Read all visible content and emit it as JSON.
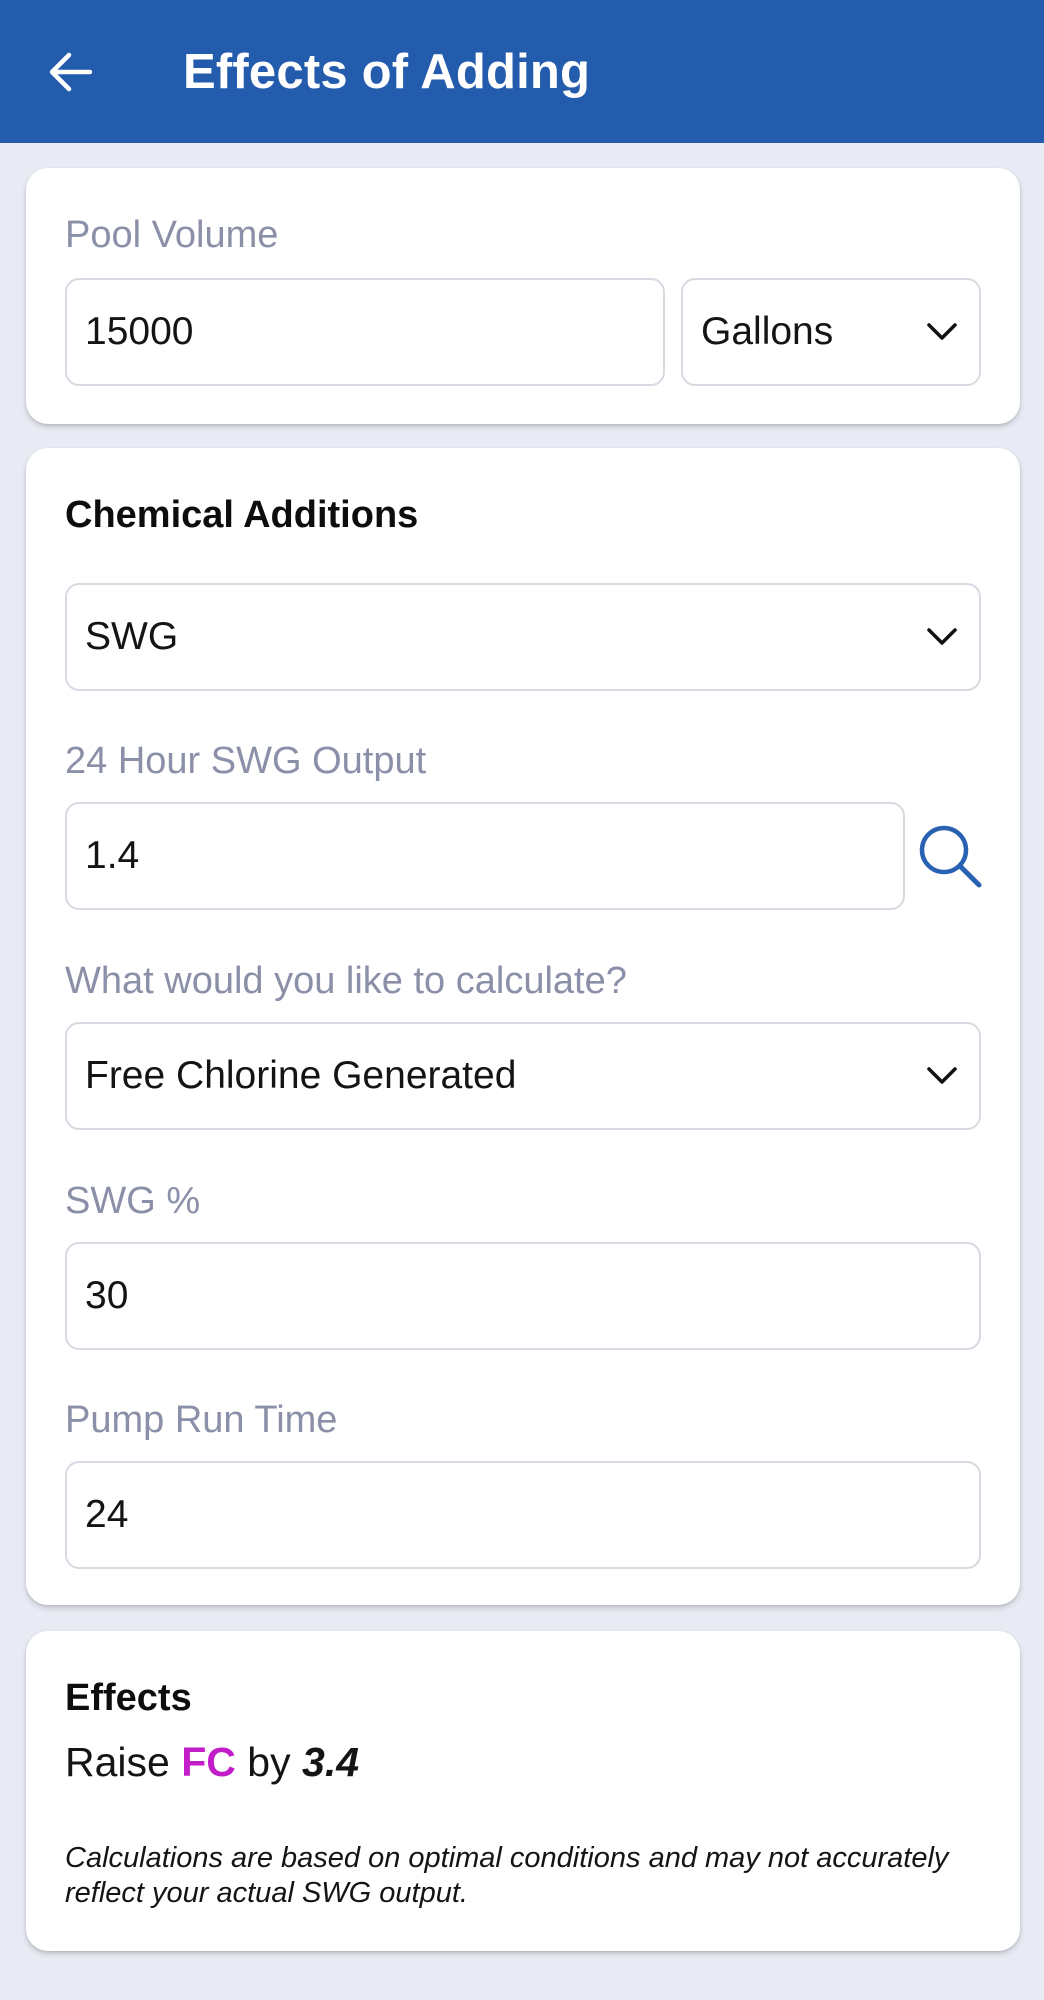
{
  "app_bar": {
    "title": "Effects of Adding",
    "back_icon": "arrow-left-icon",
    "background_color": "#235bad"
  },
  "pool_volume": {
    "label": "Pool Volume",
    "value": "15000",
    "unit_selected": "Gallons"
  },
  "chemical_additions": {
    "title": "Chemical Additions",
    "chemical_selected": "SWG",
    "swg_output": {
      "label": "24 Hour SWG Output",
      "value": "1.4",
      "lookup_icon": "search-icon"
    },
    "calculate": {
      "label": "What would you like to calculate?",
      "selected": "Free Chlorine Generated"
    },
    "swg_percent": {
      "label": "SWG %",
      "value": "30"
    },
    "pump_run_time": {
      "label": "Pump Run Time",
      "value": "24"
    }
  },
  "effects": {
    "title": "Effects",
    "prefix": "Raise",
    "chemical": "FC",
    "connector": "by",
    "amount": "3.4",
    "chemical_color": "#c31cc9",
    "disclaimer": "Calculations are based on optimal conditions and may not accurately reflect your actual SWG output."
  }
}
